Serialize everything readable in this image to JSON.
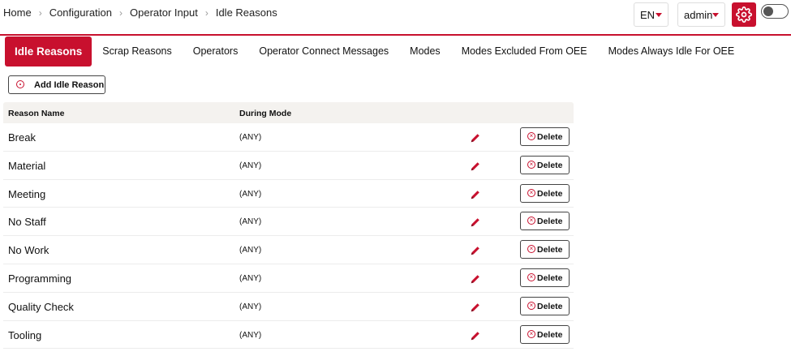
{
  "breadcrumb": [
    "Home",
    "Configuration",
    "Operator Input",
    "Idle Reasons"
  ],
  "header": {
    "language": "EN",
    "user": "admin"
  },
  "tabs": [
    {
      "label": "Idle Reasons",
      "active": true
    },
    {
      "label": "Scrap Reasons",
      "active": false
    },
    {
      "label": "Operators",
      "active": false
    },
    {
      "label": "Operator Connect Messages",
      "active": false
    },
    {
      "label": "Modes",
      "active": false
    },
    {
      "label": "Modes Excluded From OEE",
      "active": false
    },
    {
      "label": "Modes Always Idle For OEE",
      "active": false
    }
  ],
  "toolbar": {
    "add_label": "Add Idle Reason"
  },
  "table": {
    "headers": [
      "Reason Name",
      "During Mode"
    ],
    "delete_label": "Delete",
    "rows": [
      {
        "name": "Break",
        "mode": "(ANY)"
      },
      {
        "name": "Material",
        "mode": "(ANY)"
      },
      {
        "name": "Meeting",
        "mode": "(ANY)"
      },
      {
        "name": "No Staff",
        "mode": "(ANY)"
      },
      {
        "name": "No Work",
        "mode": "(ANY)"
      },
      {
        "name": "Programming",
        "mode": "(ANY)"
      },
      {
        "name": "Quality Check",
        "mode": "(ANY)"
      },
      {
        "name": "Tooling",
        "mode": "(ANY)"
      }
    ]
  },
  "colors": {
    "accent": "#c8102e",
    "header_bg": "#f4f2ef"
  },
  "icons": {
    "settings": "gear-icon",
    "edit": "pencil-icon",
    "add": "add-circle-icon",
    "delete": "close-circle-icon"
  }
}
